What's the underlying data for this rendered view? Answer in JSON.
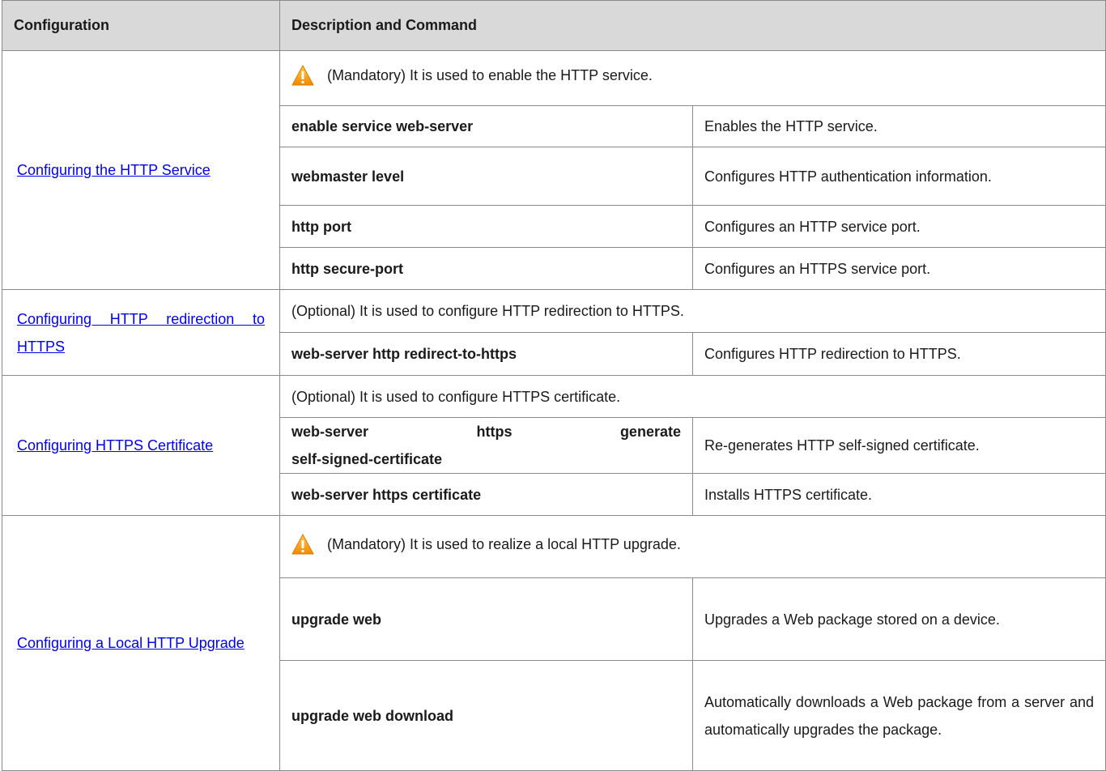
{
  "header": {
    "col1": "Configuration",
    "col2": "Description and Command"
  },
  "sections": [
    {
      "link": "Configuring the HTTP Service",
      "note": "(Mandatory) It is used to enable the HTTP service.",
      "rows": [
        {
          "cmd": "enable service web-server",
          "desc": "Enables the HTTP service."
        },
        {
          "cmd": "webmaster level",
          "desc": "Configures HTTP authentication information."
        },
        {
          "cmd": "http port",
          "desc": "Configures an HTTP service port."
        },
        {
          "cmd": "http secure-port",
          "desc": "Configures an HTTPS service port."
        }
      ]
    },
    {
      "link": "Configuring HTTP redirection to HTTPS",
      "note": "(Optional) It is used to configure HTTP redirection to HTTPS.",
      "rows": [
        {
          "cmd": "web-server http redirect-to-https",
          "desc": "Configures HTTP redirection to HTTPS."
        }
      ]
    },
    {
      "link": "Configuring HTTPS Certificate",
      "note": "(Optional) It is used to configure HTTPS certificate.",
      "rows": [
        {
          "cmd_parts": [
            "web-server",
            "https",
            "generate"
          ],
          "cmd_line2": "self-signed-certificate",
          "desc": "Re-generates HTTP self-signed certificate."
        },
        {
          "cmd": "web-server https certificate",
          "desc": "Installs HTTPS certificate."
        }
      ]
    },
    {
      "link": "Configuring a Local HTTP Upgrade",
      "note": "(Mandatory) It is used to realize a local HTTP upgrade.",
      "rows": [
        {
          "cmd": "upgrade web",
          "desc": "Upgrades a Web package stored on a device."
        },
        {
          "cmd": "upgrade web download",
          "desc": "Automatically downloads a Web package from a server and automatically upgrades the package."
        }
      ]
    }
  ],
  "icons": {
    "warning": "warning-triangle-icon",
    "warning_color": "#f5a623"
  },
  "colors": {
    "header_bg": "#d9d9d9",
    "link": "#0000ee",
    "border": "#8a8a8a"
  }
}
